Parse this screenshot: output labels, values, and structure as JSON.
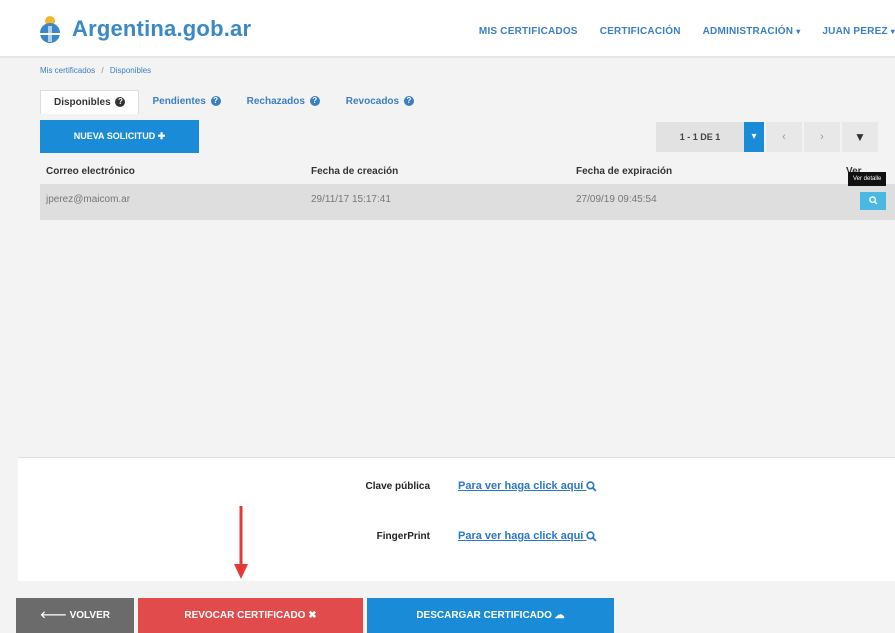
{
  "navbar": {
    "brand": "Argentina.gob.ar",
    "links": [
      "MIS CERTIFICADOS",
      "CERTIFICACIÓN",
      "ADMINISTRACIÓN",
      "JUAN PEREZ"
    ]
  },
  "breadcrumb": {
    "root": "Mis certificados",
    "current": "Disponibles"
  },
  "tabs": [
    "Disponibles",
    "Pendientes",
    "Rechazados",
    "Revocados"
  ],
  "new_request_label": "NUEVA SOLICITUD",
  "pager": {
    "info": "1 - 1 DE 1",
    "prev": "‹",
    "next": "›"
  },
  "table": {
    "headers": [
      "Correo electrónico",
      "Fecha de creación",
      "Fecha de expiración",
      "Ver"
    ],
    "rows": [
      {
        "email": "jperez@maicom.ar",
        "created": "29/11/17 15:17:41",
        "expires": "27/09/19 09:45:54"
      }
    ],
    "tooltip": "Ver detalle"
  },
  "details": {
    "public_key_label": "Clave pública",
    "public_key_link": "Para ver haga click aquí",
    "fingerprint_label": "FingerPrint",
    "fingerprint_link": "Para ver haga click aquí"
  },
  "footer": {
    "back": "VOLVER",
    "revoke": "REVOCAR CERTIFICADO",
    "download": "DESCARGAR CERTIFICADO"
  },
  "colors": {
    "primary": "#1a8bd6",
    "link": "#3a7fc0",
    "danger": "#e24b4b",
    "back": "#6b6b6b",
    "arrow": "#e53935"
  }
}
